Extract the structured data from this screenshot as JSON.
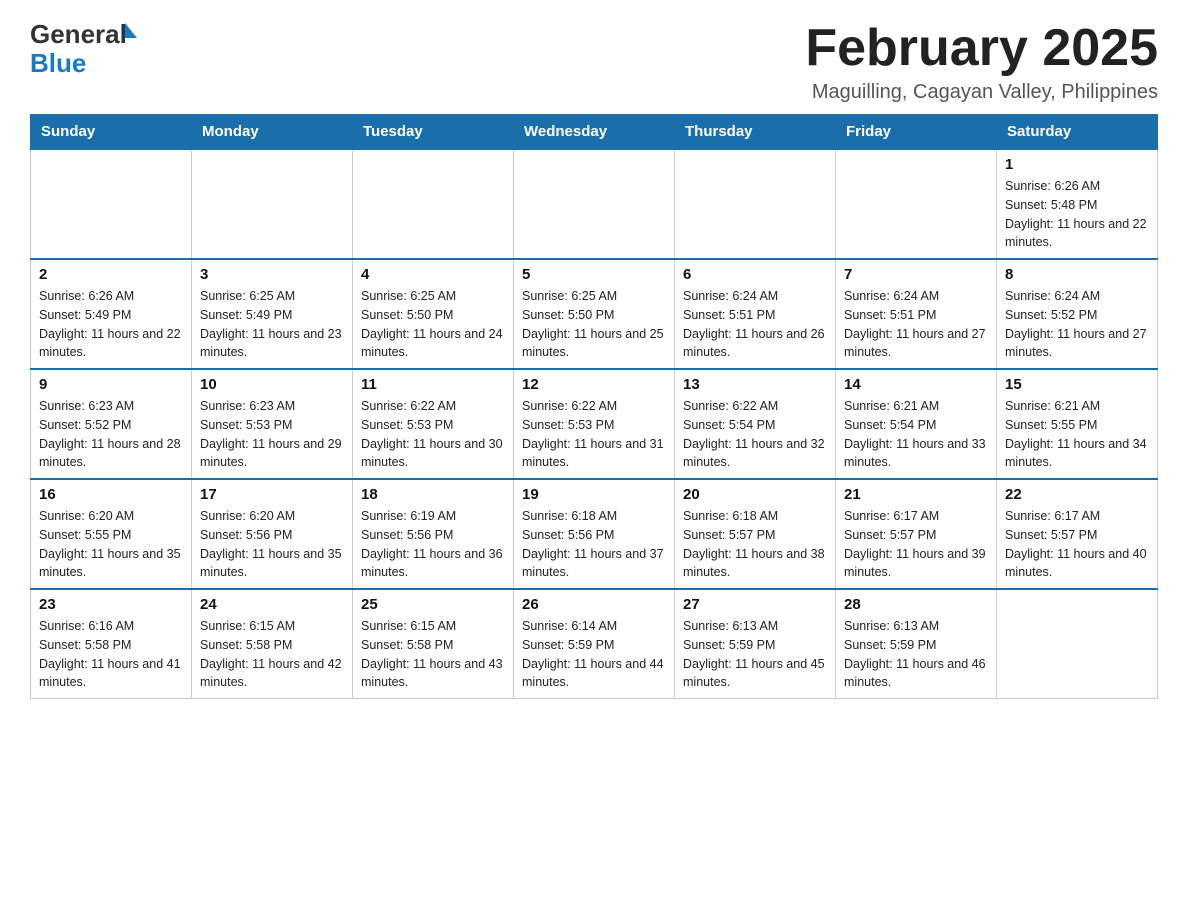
{
  "header": {
    "logo_general": "General",
    "logo_blue": "Blue",
    "month_title": "February 2025",
    "location": "Maguilling, Cagayan Valley, Philippines"
  },
  "days_of_week": [
    "Sunday",
    "Monday",
    "Tuesday",
    "Wednesday",
    "Thursday",
    "Friday",
    "Saturday"
  ],
  "weeks": [
    [
      {
        "day": "",
        "info": ""
      },
      {
        "day": "",
        "info": ""
      },
      {
        "day": "",
        "info": ""
      },
      {
        "day": "",
        "info": ""
      },
      {
        "day": "",
        "info": ""
      },
      {
        "day": "",
        "info": ""
      },
      {
        "day": "1",
        "info": "Sunrise: 6:26 AM\nSunset: 5:48 PM\nDaylight: 11 hours and 22 minutes."
      }
    ],
    [
      {
        "day": "2",
        "info": "Sunrise: 6:26 AM\nSunset: 5:49 PM\nDaylight: 11 hours and 22 minutes."
      },
      {
        "day": "3",
        "info": "Sunrise: 6:25 AM\nSunset: 5:49 PM\nDaylight: 11 hours and 23 minutes."
      },
      {
        "day": "4",
        "info": "Sunrise: 6:25 AM\nSunset: 5:50 PM\nDaylight: 11 hours and 24 minutes."
      },
      {
        "day": "5",
        "info": "Sunrise: 6:25 AM\nSunset: 5:50 PM\nDaylight: 11 hours and 25 minutes."
      },
      {
        "day": "6",
        "info": "Sunrise: 6:24 AM\nSunset: 5:51 PM\nDaylight: 11 hours and 26 minutes."
      },
      {
        "day": "7",
        "info": "Sunrise: 6:24 AM\nSunset: 5:51 PM\nDaylight: 11 hours and 27 minutes."
      },
      {
        "day": "8",
        "info": "Sunrise: 6:24 AM\nSunset: 5:52 PM\nDaylight: 11 hours and 27 minutes."
      }
    ],
    [
      {
        "day": "9",
        "info": "Sunrise: 6:23 AM\nSunset: 5:52 PM\nDaylight: 11 hours and 28 minutes."
      },
      {
        "day": "10",
        "info": "Sunrise: 6:23 AM\nSunset: 5:53 PM\nDaylight: 11 hours and 29 minutes."
      },
      {
        "day": "11",
        "info": "Sunrise: 6:22 AM\nSunset: 5:53 PM\nDaylight: 11 hours and 30 minutes."
      },
      {
        "day": "12",
        "info": "Sunrise: 6:22 AM\nSunset: 5:53 PM\nDaylight: 11 hours and 31 minutes."
      },
      {
        "day": "13",
        "info": "Sunrise: 6:22 AM\nSunset: 5:54 PM\nDaylight: 11 hours and 32 minutes."
      },
      {
        "day": "14",
        "info": "Sunrise: 6:21 AM\nSunset: 5:54 PM\nDaylight: 11 hours and 33 minutes."
      },
      {
        "day": "15",
        "info": "Sunrise: 6:21 AM\nSunset: 5:55 PM\nDaylight: 11 hours and 34 minutes."
      }
    ],
    [
      {
        "day": "16",
        "info": "Sunrise: 6:20 AM\nSunset: 5:55 PM\nDaylight: 11 hours and 35 minutes."
      },
      {
        "day": "17",
        "info": "Sunrise: 6:20 AM\nSunset: 5:56 PM\nDaylight: 11 hours and 35 minutes."
      },
      {
        "day": "18",
        "info": "Sunrise: 6:19 AM\nSunset: 5:56 PM\nDaylight: 11 hours and 36 minutes."
      },
      {
        "day": "19",
        "info": "Sunrise: 6:18 AM\nSunset: 5:56 PM\nDaylight: 11 hours and 37 minutes."
      },
      {
        "day": "20",
        "info": "Sunrise: 6:18 AM\nSunset: 5:57 PM\nDaylight: 11 hours and 38 minutes."
      },
      {
        "day": "21",
        "info": "Sunrise: 6:17 AM\nSunset: 5:57 PM\nDaylight: 11 hours and 39 minutes."
      },
      {
        "day": "22",
        "info": "Sunrise: 6:17 AM\nSunset: 5:57 PM\nDaylight: 11 hours and 40 minutes."
      }
    ],
    [
      {
        "day": "23",
        "info": "Sunrise: 6:16 AM\nSunset: 5:58 PM\nDaylight: 11 hours and 41 minutes."
      },
      {
        "day": "24",
        "info": "Sunrise: 6:15 AM\nSunset: 5:58 PM\nDaylight: 11 hours and 42 minutes."
      },
      {
        "day": "25",
        "info": "Sunrise: 6:15 AM\nSunset: 5:58 PM\nDaylight: 11 hours and 43 minutes."
      },
      {
        "day": "26",
        "info": "Sunrise: 6:14 AM\nSunset: 5:59 PM\nDaylight: 11 hours and 44 minutes."
      },
      {
        "day": "27",
        "info": "Sunrise: 6:13 AM\nSunset: 5:59 PM\nDaylight: 11 hours and 45 minutes."
      },
      {
        "day": "28",
        "info": "Sunrise: 6:13 AM\nSunset: 5:59 PM\nDaylight: 11 hours and 46 minutes."
      },
      {
        "day": "",
        "info": ""
      }
    ]
  ]
}
